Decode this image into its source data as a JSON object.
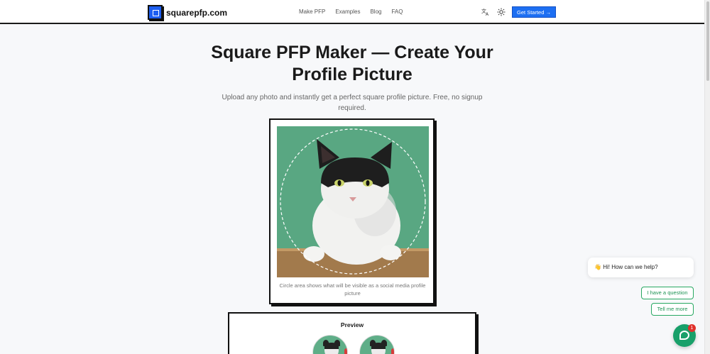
{
  "header": {
    "logo_text": "squarepfp.com",
    "nav": [
      "Make PFP",
      "Examples",
      "Blog",
      "FAQ"
    ],
    "translate_icon": "translate-icon",
    "theme_icon": "sun-icon",
    "cta_label": "Get Started",
    "cta_arrow": "→"
  },
  "hero": {
    "title": "Square PFP Maker — Create Your Profile Picture",
    "subtitle": "Upload any photo and instantly get a perfect square profile picture. Free, no signup required."
  },
  "editor": {
    "caption": "Circle area shows what will be visible as a social media profile picture"
  },
  "preview": {
    "title": "Preview"
  },
  "chat": {
    "greeting_emoji": "👋",
    "greeting": "Hi! How can we help?",
    "options": [
      "I have a question",
      "Tell me more"
    ],
    "badge_count": "1"
  },
  "colors": {
    "accent": "#1d6ff2",
    "photo_bg": "#5fae88",
    "chat_green": "#18a06a"
  }
}
